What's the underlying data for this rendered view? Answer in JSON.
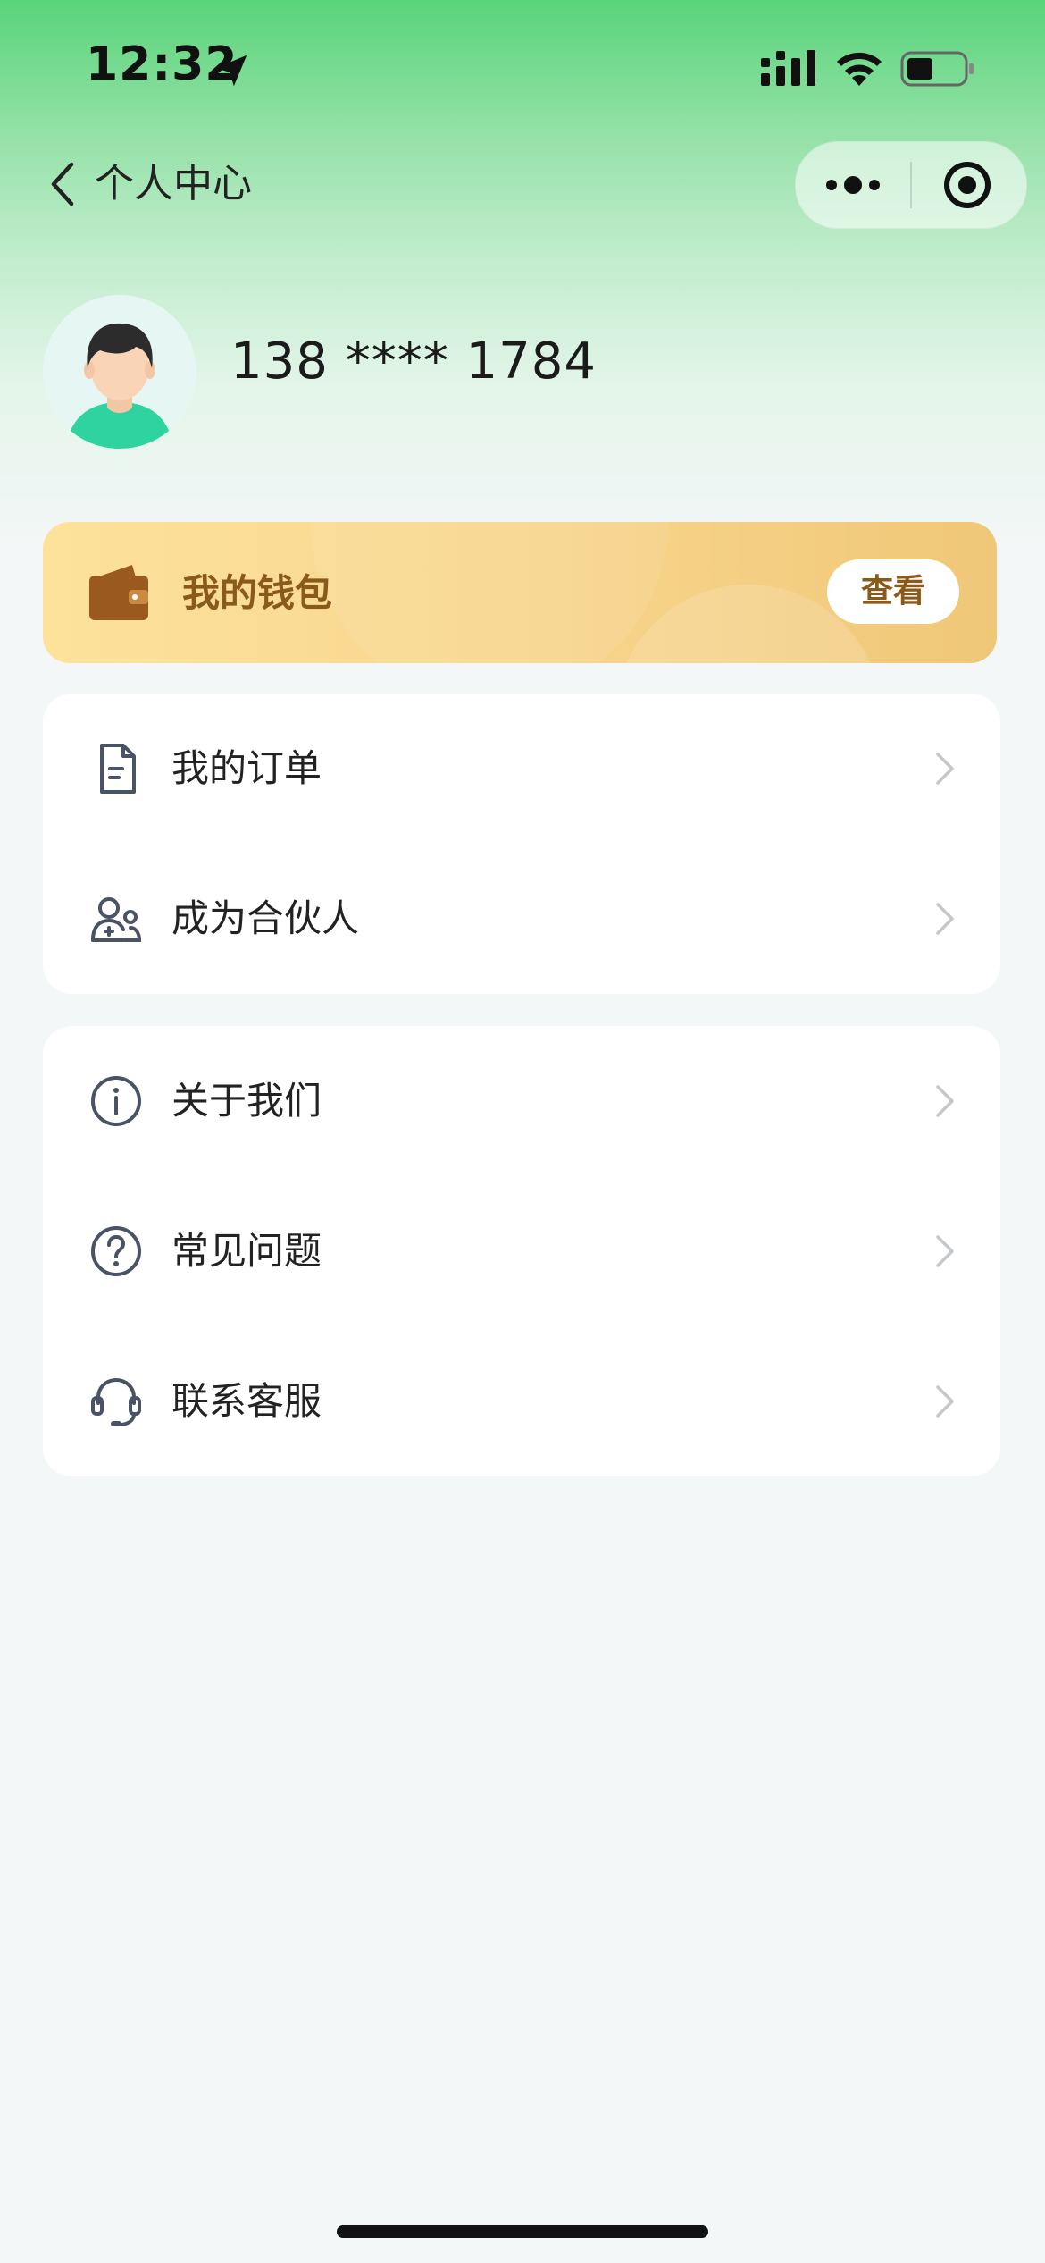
{
  "status_bar": {
    "time": "12:32"
  },
  "nav": {
    "title": "个人中心"
  },
  "profile": {
    "phone": "138 **** 1784"
  },
  "wallet": {
    "label": "我的钱包",
    "button": "查看"
  },
  "menu_group_1": [
    {
      "label": "我的订单",
      "icon": "document-icon"
    },
    {
      "label": "成为合伙人",
      "icon": "partner-icon"
    }
  ],
  "menu_group_2": [
    {
      "label": "关于我们",
      "icon": "info-icon"
    },
    {
      "label": "常见问题",
      "icon": "question-icon"
    },
    {
      "label": "联系客服",
      "icon": "headset-icon"
    }
  ],
  "colors": {
    "header_green": "#59d47a",
    "wallet_gold": "#f8d68d",
    "wallet_text": "#8a5a1c",
    "icon_gray": "#4a5266",
    "background": "#f4f7f8"
  }
}
